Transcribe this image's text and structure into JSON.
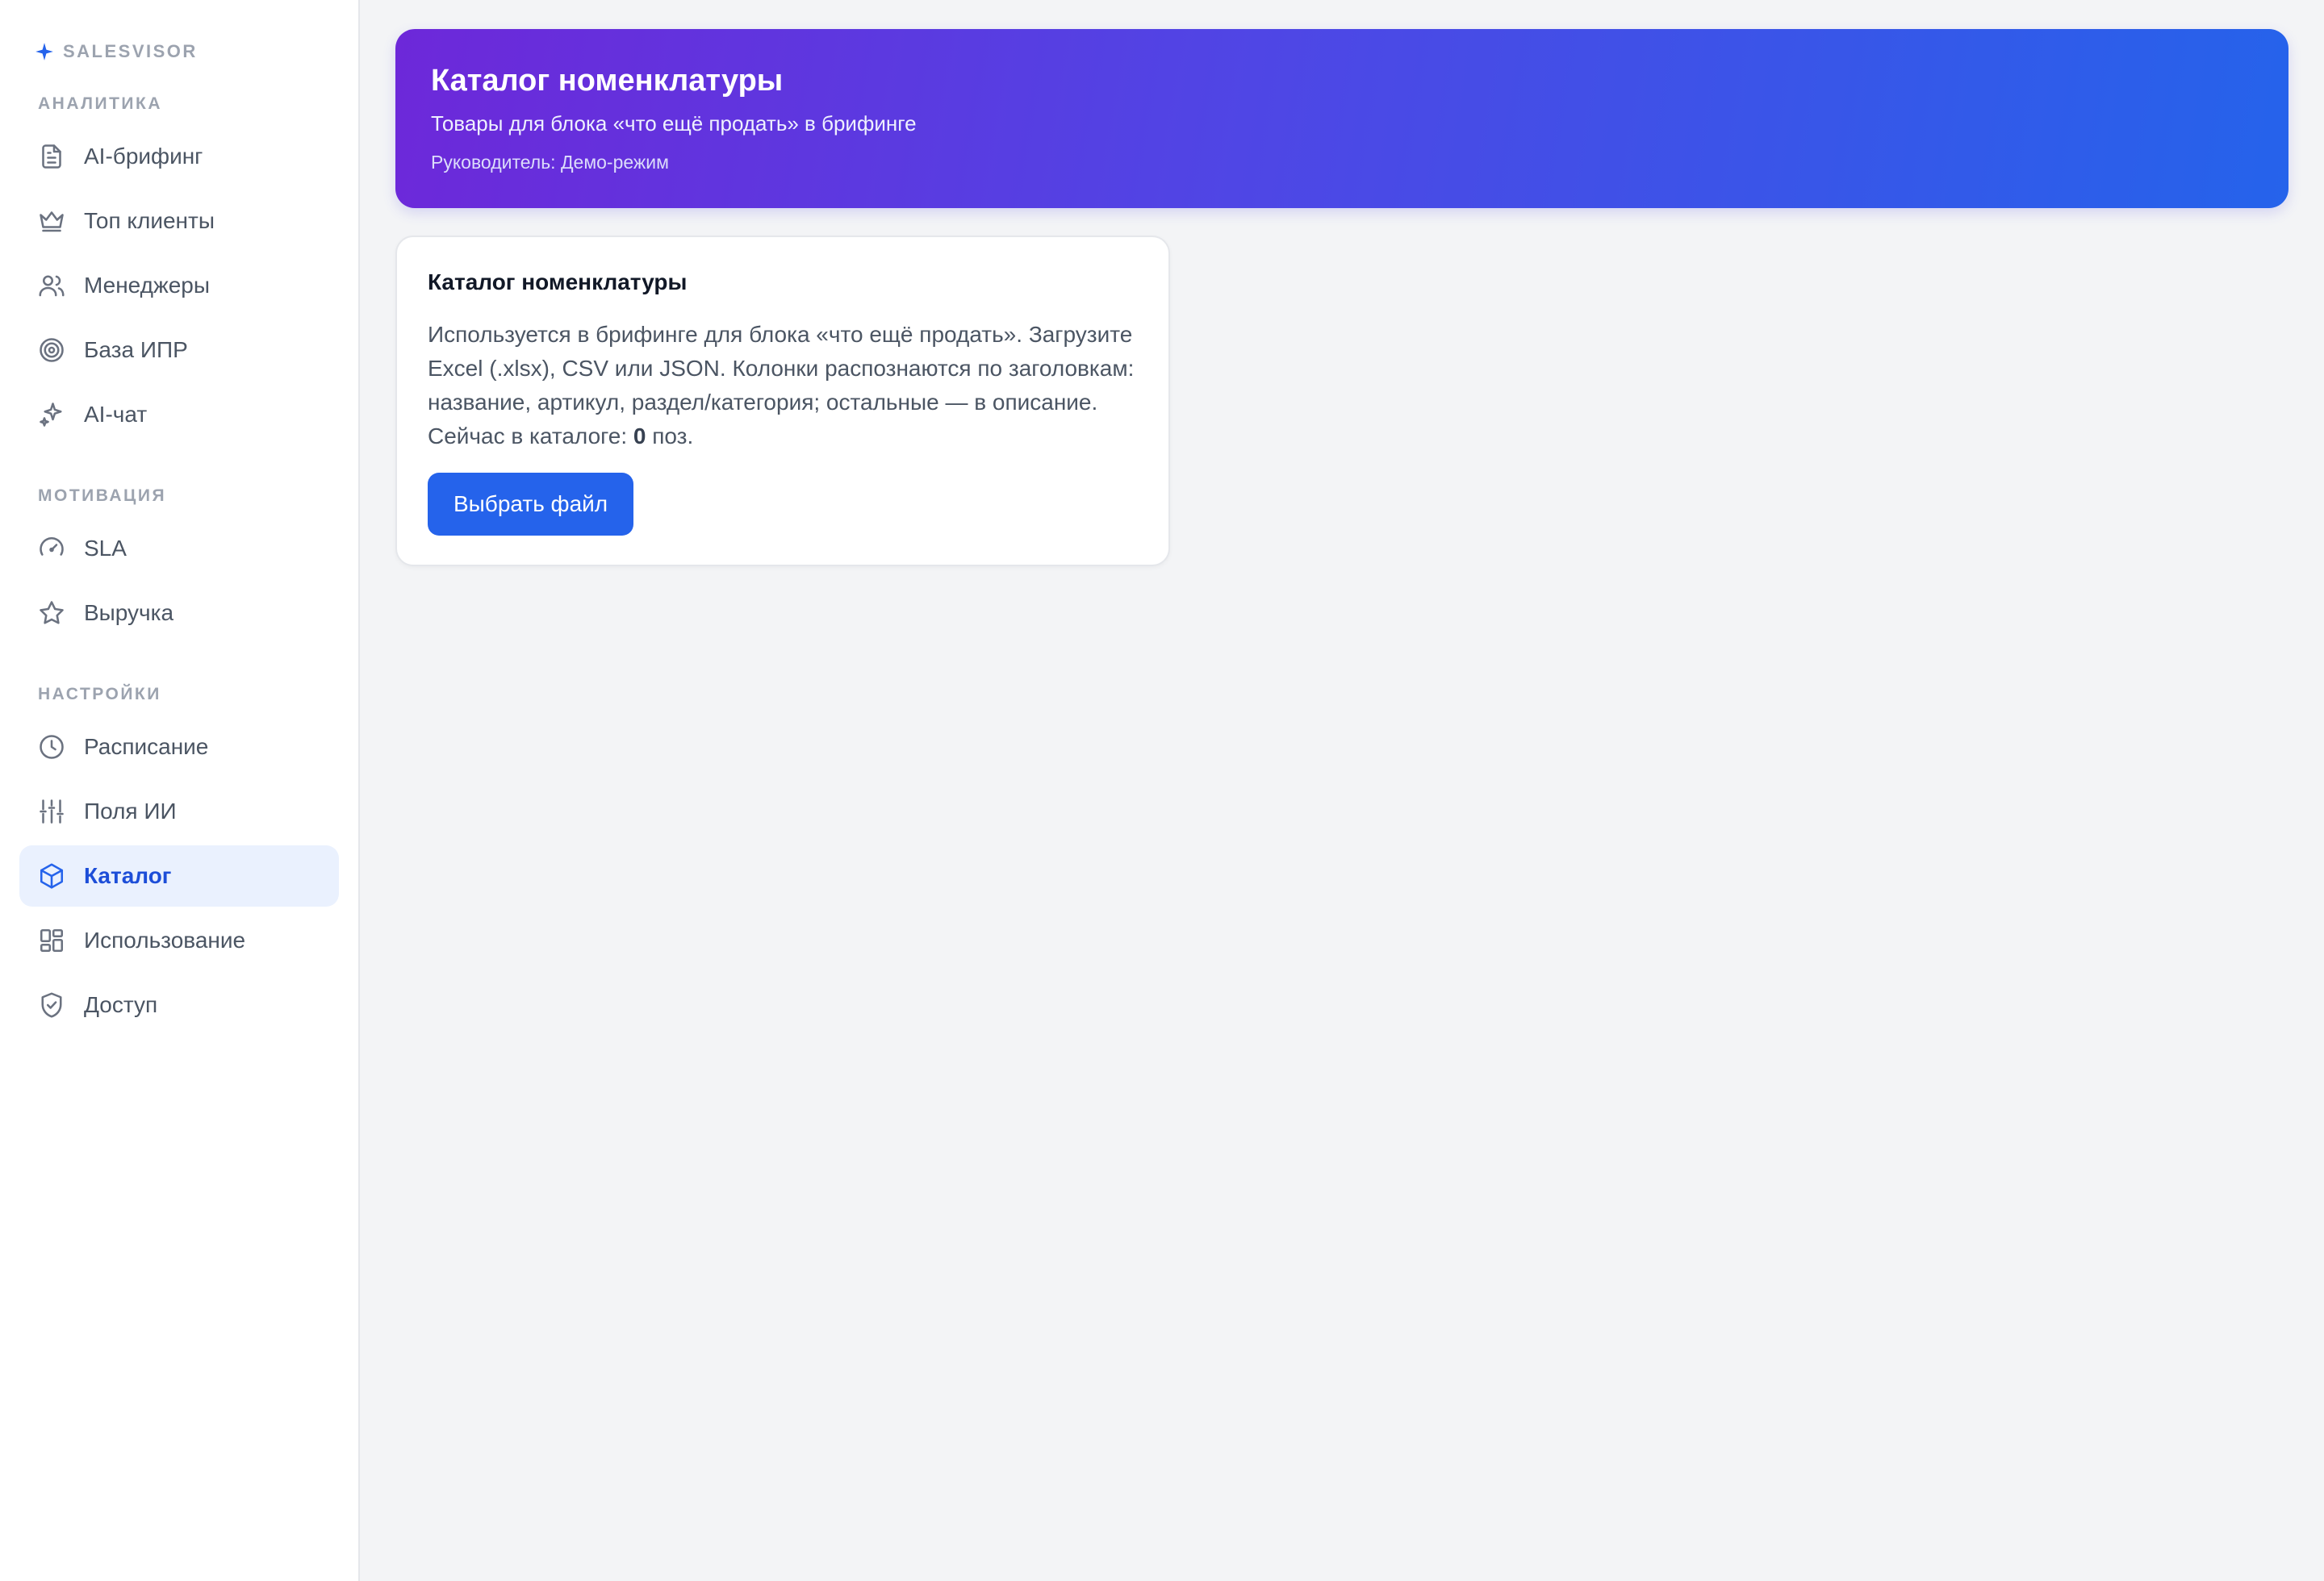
{
  "brand": {
    "name": "SALESVISOR",
    "icon": "sparkle-icon",
    "accent": "#2563eb"
  },
  "sidebar": {
    "sections": [
      {
        "title": "АНАЛИТИКА",
        "items": [
          {
            "label": "AI-брифинг",
            "icon": "document-icon"
          },
          {
            "label": "Топ клиенты",
            "icon": "crown-icon"
          },
          {
            "label": "Менеджеры",
            "icon": "users-icon"
          },
          {
            "label": "База ИПР",
            "icon": "target-icon"
          },
          {
            "label": "AI-чат",
            "icon": "sparkles-icon"
          }
        ]
      },
      {
        "title": "МОТИВАЦИЯ",
        "items": [
          {
            "label": "SLA",
            "icon": "gauge-icon"
          },
          {
            "label": "Выручка",
            "icon": "star-icon"
          }
        ]
      },
      {
        "title": "НАСТРОЙКИ",
        "items": [
          {
            "label": "Расписание",
            "icon": "clock-icon"
          },
          {
            "label": "Поля ИИ",
            "icon": "sliders-icon"
          },
          {
            "label": "Каталог",
            "icon": "cube-icon",
            "active": true
          },
          {
            "label": "Использование",
            "icon": "layout-icon"
          },
          {
            "label": "Доступ",
            "icon": "shield-icon"
          }
        ]
      }
    ]
  },
  "hero": {
    "title": "Каталог номенклатуры",
    "subtitle": "Товары для блока «что ещё продать» в брифинге",
    "meta": "Руководитель: Демо-режим",
    "gradient": [
      "#6d28d9",
      "#2563eb"
    ]
  },
  "card": {
    "title": "Каталог номенклатуры",
    "text_before": "Используется в брифинге для блока «что ещё продать». Загрузите Excel (.xlsx), CSV или JSON. Колонки распознаются по заголовкам: название, артикул, раздел/категория; остальные — в описание. Сейчас в каталоге: ",
    "count": "0",
    "text_after": " поз.",
    "button_label": "Выбрать файл"
  }
}
